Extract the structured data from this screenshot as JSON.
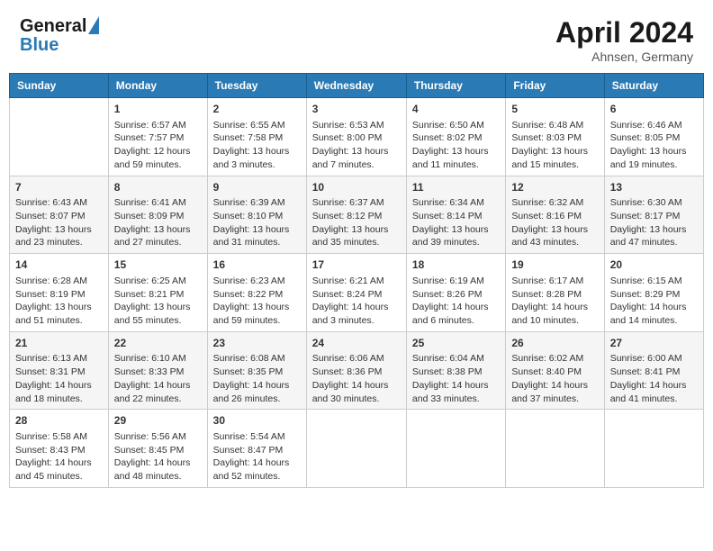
{
  "header": {
    "logo_line1": "General",
    "logo_line2": "Blue",
    "month": "April 2024",
    "location": "Ahnsen, Germany"
  },
  "days_of_week": [
    "Sunday",
    "Monday",
    "Tuesday",
    "Wednesday",
    "Thursday",
    "Friday",
    "Saturday"
  ],
  "weeks": [
    [
      {
        "day": "",
        "info": ""
      },
      {
        "day": "1",
        "info": "Sunrise: 6:57 AM\nSunset: 7:57 PM\nDaylight: 12 hours\nand 59 minutes."
      },
      {
        "day": "2",
        "info": "Sunrise: 6:55 AM\nSunset: 7:58 PM\nDaylight: 13 hours\nand 3 minutes."
      },
      {
        "day": "3",
        "info": "Sunrise: 6:53 AM\nSunset: 8:00 PM\nDaylight: 13 hours\nand 7 minutes."
      },
      {
        "day": "4",
        "info": "Sunrise: 6:50 AM\nSunset: 8:02 PM\nDaylight: 13 hours\nand 11 minutes."
      },
      {
        "day": "5",
        "info": "Sunrise: 6:48 AM\nSunset: 8:03 PM\nDaylight: 13 hours\nand 15 minutes."
      },
      {
        "day": "6",
        "info": "Sunrise: 6:46 AM\nSunset: 8:05 PM\nDaylight: 13 hours\nand 19 minutes."
      }
    ],
    [
      {
        "day": "7",
        "info": "Sunrise: 6:43 AM\nSunset: 8:07 PM\nDaylight: 13 hours\nand 23 minutes."
      },
      {
        "day": "8",
        "info": "Sunrise: 6:41 AM\nSunset: 8:09 PM\nDaylight: 13 hours\nand 27 minutes."
      },
      {
        "day": "9",
        "info": "Sunrise: 6:39 AM\nSunset: 8:10 PM\nDaylight: 13 hours\nand 31 minutes."
      },
      {
        "day": "10",
        "info": "Sunrise: 6:37 AM\nSunset: 8:12 PM\nDaylight: 13 hours\nand 35 minutes."
      },
      {
        "day": "11",
        "info": "Sunrise: 6:34 AM\nSunset: 8:14 PM\nDaylight: 13 hours\nand 39 minutes."
      },
      {
        "day": "12",
        "info": "Sunrise: 6:32 AM\nSunset: 8:16 PM\nDaylight: 13 hours\nand 43 minutes."
      },
      {
        "day": "13",
        "info": "Sunrise: 6:30 AM\nSunset: 8:17 PM\nDaylight: 13 hours\nand 47 minutes."
      }
    ],
    [
      {
        "day": "14",
        "info": "Sunrise: 6:28 AM\nSunset: 8:19 PM\nDaylight: 13 hours\nand 51 minutes."
      },
      {
        "day": "15",
        "info": "Sunrise: 6:25 AM\nSunset: 8:21 PM\nDaylight: 13 hours\nand 55 minutes."
      },
      {
        "day": "16",
        "info": "Sunrise: 6:23 AM\nSunset: 8:22 PM\nDaylight: 13 hours\nand 59 minutes."
      },
      {
        "day": "17",
        "info": "Sunrise: 6:21 AM\nSunset: 8:24 PM\nDaylight: 14 hours\nand 3 minutes."
      },
      {
        "day": "18",
        "info": "Sunrise: 6:19 AM\nSunset: 8:26 PM\nDaylight: 14 hours\nand 6 minutes."
      },
      {
        "day": "19",
        "info": "Sunrise: 6:17 AM\nSunset: 8:28 PM\nDaylight: 14 hours\nand 10 minutes."
      },
      {
        "day": "20",
        "info": "Sunrise: 6:15 AM\nSunset: 8:29 PM\nDaylight: 14 hours\nand 14 minutes."
      }
    ],
    [
      {
        "day": "21",
        "info": "Sunrise: 6:13 AM\nSunset: 8:31 PM\nDaylight: 14 hours\nand 18 minutes."
      },
      {
        "day": "22",
        "info": "Sunrise: 6:10 AM\nSunset: 8:33 PM\nDaylight: 14 hours\nand 22 minutes."
      },
      {
        "day": "23",
        "info": "Sunrise: 6:08 AM\nSunset: 8:35 PM\nDaylight: 14 hours\nand 26 minutes."
      },
      {
        "day": "24",
        "info": "Sunrise: 6:06 AM\nSunset: 8:36 PM\nDaylight: 14 hours\nand 30 minutes."
      },
      {
        "day": "25",
        "info": "Sunrise: 6:04 AM\nSunset: 8:38 PM\nDaylight: 14 hours\nand 33 minutes."
      },
      {
        "day": "26",
        "info": "Sunrise: 6:02 AM\nSunset: 8:40 PM\nDaylight: 14 hours\nand 37 minutes."
      },
      {
        "day": "27",
        "info": "Sunrise: 6:00 AM\nSunset: 8:41 PM\nDaylight: 14 hours\nand 41 minutes."
      }
    ],
    [
      {
        "day": "28",
        "info": "Sunrise: 5:58 AM\nSunset: 8:43 PM\nDaylight: 14 hours\nand 45 minutes."
      },
      {
        "day": "29",
        "info": "Sunrise: 5:56 AM\nSunset: 8:45 PM\nDaylight: 14 hours\nand 48 minutes."
      },
      {
        "day": "30",
        "info": "Sunrise: 5:54 AM\nSunset: 8:47 PM\nDaylight: 14 hours\nand 52 minutes."
      },
      {
        "day": "",
        "info": ""
      },
      {
        "day": "",
        "info": ""
      },
      {
        "day": "",
        "info": ""
      },
      {
        "day": "",
        "info": ""
      }
    ]
  ]
}
